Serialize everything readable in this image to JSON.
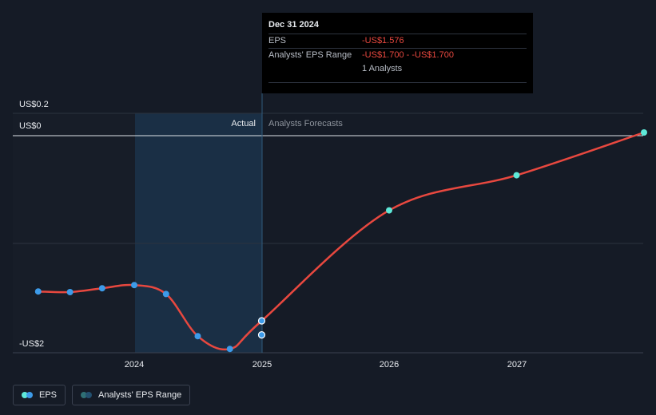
{
  "chart_data": {
    "type": "line",
    "y_axis": {
      "labels": [
        "US$0.2",
        "US$0",
        "-US$2"
      ]
    },
    "x_axis": {
      "ticks": [
        "2024",
        "2025",
        "2026",
        "2027"
      ]
    },
    "regions": {
      "actual_label": "Actual",
      "forecast_label": "Analysts Forecasts"
    },
    "series": [
      {
        "name": "EPS",
        "color": "#e8483f",
        "points": [
          {
            "x": "2023-04-01",
            "y": -1.22
          },
          {
            "x": "2023-07-01",
            "y": -1.225
          },
          {
            "x": "2023-10-01",
            "y": -1.195
          },
          {
            "x": "2024-01-01",
            "y": -1.17
          },
          {
            "x": "2024-04-01",
            "y": -1.24
          },
          {
            "x": "2024-07-01",
            "y": -1.57
          },
          {
            "x": "2024-10-01",
            "y": -1.67
          },
          {
            "x": "2024-12-31",
            "y": -1.45
          },
          {
            "x": "2025-12-31",
            "y": -0.585
          },
          {
            "x": "2026-12-31",
            "y": -0.31
          },
          {
            "x": "2027-12-31",
            "y": 0.025
          }
        ]
      },
      {
        "name": "Analysts' EPS Range",
        "points": [
          {
            "x": "2024-12-31",
            "y": -1.56
          }
        ]
      }
    ]
  },
  "tooltip": {
    "date": "Dec 31 2024",
    "rows": [
      {
        "key": "EPS",
        "value": "-US$1.576"
      },
      {
        "key": "Analysts' EPS Range",
        "value": "-US$1.700 - -US$1.700"
      }
    ],
    "analysts": "1 Analysts"
  },
  "legend": {
    "items": [
      {
        "label": "EPS",
        "colors": [
          "#5ee8d8",
          "#3d9be9"
        ]
      },
      {
        "label": "Analysts' EPS Range",
        "colors": [
          "#2f6f74",
          "#23506f"
        ]
      }
    ]
  },
  "colors": {
    "background": "#151b26",
    "actual_shade": "#1a2f45",
    "past_marker": "#3d9be9",
    "forecast_marker": "#5ee8d8"
  }
}
